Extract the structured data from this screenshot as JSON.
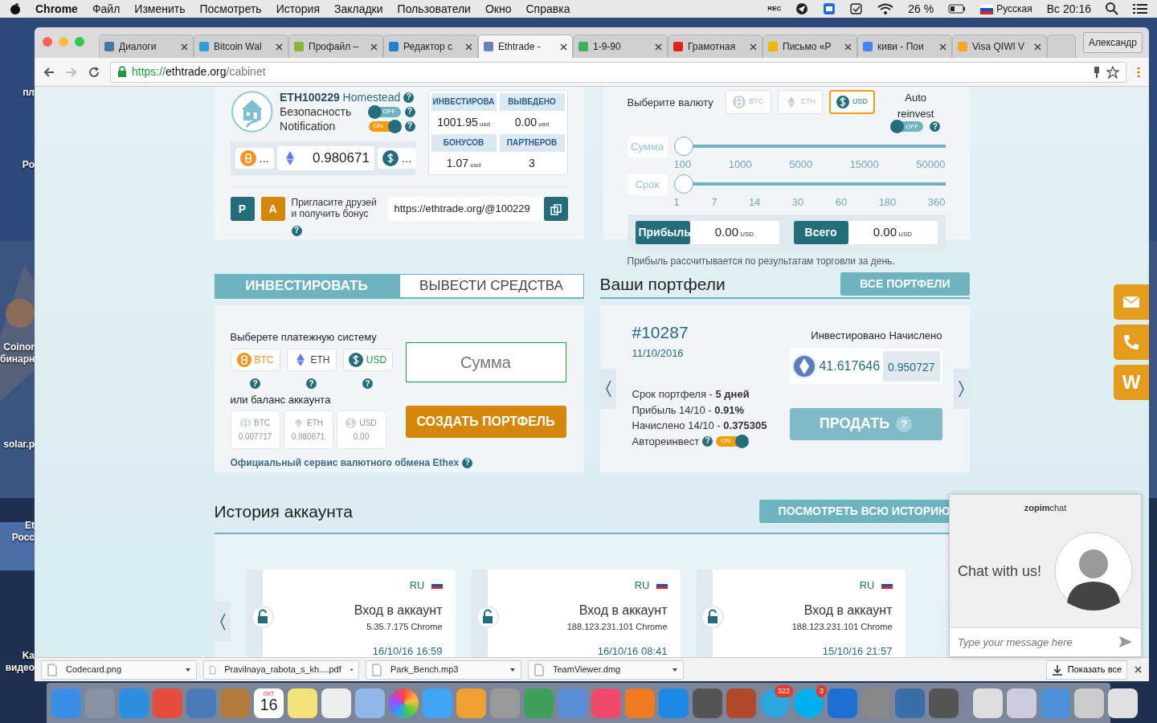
{
  "menubar": {
    "app": "Chrome",
    "items": [
      "Файл",
      "Изменить",
      "Посмотреть",
      "История",
      "Закладки",
      "Пользователи",
      "Окно",
      "Справка"
    ],
    "rec": "REC",
    "battery": "26 %",
    "input_source": "Русская",
    "clock": "Вс 20:16"
  },
  "desktop_icons": [
    {
      "lines": [
        "пл"
      ]
    },
    {
      "lines": [
        "Po"
      ]
    },
    {
      "lines": [
        "Coinor",
        "бинарн"
      ]
    },
    {
      "lines": [
        "solar.p"
      ]
    },
    {
      "lines": [
        "Et",
        "Росс"
      ]
    },
    {
      "lines": [
        "Ka",
        "видео"
      ]
    }
  ],
  "browser": {
    "tabs": [
      {
        "title": "Диалоги",
        "color": "#4a76a8",
        "selected": false
      },
      {
        "title": "Bitcoin Wal",
        "color": "#2a9fd6",
        "selected": false
      },
      {
        "title": "Профайл –",
        "color": "#8db33a",
        "selected": false
      },
      {
        "title": "Редактор с",
        "color": "#1f7fd1",
        "selected": false
      },
      {
        "title": "Ethtrade - ",
        "color": "#6b7fb8",
        "selected": true
      },
      {
        "title": "1-9-90",
        "color": "#3cb55a",
        "selected": false
      },
      {
        "title": "Грамотная",
        "color": "#e62117",
        "selected": false
      },
      {
        "title": "Письмо «Р",
        "color": "#f2b705",
        "selected": false
      },
      {
        "title": "киви - Пои",
        "color": "#4285f4",
        "selected": false
      },
      {
        "title": "Visa QIWI V",
        "color": "#f5a623",
        "selected": false
      }
    ],
    "profile": "Александр",
    "url": {
      "scheme": "https://",
      "host": "ethtrade.org",
      "path": "/cabinet"
    }
  },
  "account": {
    "id": "ETH100229",
    "name": "Homestead",
    "help": "?",
    "toggles": [
      {
        "label": "Безопасность",
        "on": false,
        "text": "OFF",
        "help": "?"
      },
      {
        "label": "Notification",
        "on": true,
        "text": "ON",
        "help": "?"
      }
    ],
    "balances": [
      {
        "kind": "btc",
        "value": "..."
      },
      {
        "kind": "eth",
        "value": "0.980671"
      },
      {
        "kind": "usd",
        "value": "..."
      }
    ],
    "stats": [
      {
        "label": "ИНВЕСТИРОВА",
        "value": "1001.95",
        "unit": "usd"
      },
      {
        "label": "ВЫВЕДЕНО",
        "value": "0.00",
        "unit": "usd"
      },
      {
        "label": "БОНУСОВ",
        "value": "1.07",
        "unit": "usd"
      },
      {
        "label": "ПАРТНЕРОВ",
        "value": "3"
      }
    ],
    "referral": {
      "buttons": [
        {
          "label": "P",
          "color": "#236e7a"
        },
        {
          "label": "A",
          "color": "#d4870a"
        }
      ],
      "text": "Пригласите друзей и получить бонус",
      "help": "?",
      "link": "https://ethtrade.org/@100229"
    }
  },
  "calculator": {
    "title": "Выберите валюту",
    "currencies": [
      {
        "kind": "btc",
        "label": "BTC",
        "selected": false
      },
      {
        "kind": "eth",
        "label": "ETH",
        "selected": false
      },
      {
        "kind": "usd",
        "label": "USD",
        "selected": true
      }
    ],
    "auto_reinvest": {
      "label": "Auto reinvest",
      "on": false,
      "text": "OFF",
      "help": "?"
    },
    "sliders": [
      {
        "label": "Сумма",
        "level": 0,
        "ticks": [
          "100",
          "1000",
          "5000",
          "15000",
          "50000"
        ]
      },
      {
        "label": "Срок",
        "level": 0,
        "ticks": [
          "1",
          "7",
          "14",
          "30",
          "60",
          "180",
          "360"
        ]
      }
    ],
    "results": [
      {
        "label": "Прибыль",
        "value": "0.00",
        "unit": "USD"
      },
      {
        "label": "Всего",
        "value": "0.00",
        "unit": "USD"
      }
    ],
    "note": "Прибыль рассчитывается по результатам торговли за день."
  },
  "invest": {
    "tabs": [
      {
        "label": "ИНВЕСТИРОВАТЬ",
        "selected": true
      },
      {
        "label": "ВЫВЕСТИ СРЕДСТВА",
        "selected": false
      }
    ],
    "payment_label": "Выберете платежную систему",
    "systems": [
      {
        "kind": "btc",
        "label": "BTC",
        "help": "?"
      },
      {
        "kind": "eth",
        "label": "ETH",
        "help": "?"
      },
      {
        "kind": "usd",
        "label": "USD",
        "help": "?"
      }
    ],
    "balance_label": "или баланс аккаунта",
    "balances": [
      {
        "kind": "btc",
        "label": "BTC",
        "value": "0.007717"
      },
      {
        "kind": "eth",
        "label": "ETH",
        "value": "0.980671"
      },
      {
        "kind": "usd",
        "label": "USD",
        "value": "0.00"
      }
    ],
    "amount_placeholder": "Сумма",
    "create_button": "СОЗДАТЬ ПОРТФЕЛЬ",
    "exchange_link": "Официальный сервис валютного обмена Ethex",
    "exchange_help": "?"
  },
  "portfolios": {
    "title": "Ваши портфели",
    "all_button": "ВСЕ ПОРТФЕЛИ",
    "item": {
      "number": "#10287",
      "date": "11/10/2016",
      "invested_label": "Инвестировано",
      "accrued_label": "Начислено",
      "invested": "41.617646",
      "accrued": "0.950727",
      "details": [
        "Срок портфеля - **5 дней**",
        "Прибыль 14/10 - **0.91%**",
        "Начислено 14/10 - **0.375305**"
      ],
      "reinvest": {
        "label": "Автореинвест",
        "help": "?",
        "on": true,
        "text": "ON"
      },
      "sell_button": "ПРОДАТЬ",
      "sell_help": "?"
    }
  },
  "history": {
    "title": "История аккаунта",
    "all_button": "ПОСМОТРЕТЬ ВСЮ ИСТОРИЮ",
    "events": [
      {
        "country": "RU",
        "title": "Вход в аккаунт",
        "detail": "5.35.7.175 Chrome",
        "time": "16/10/16 16:59"
      },
      {
        "country": "RU",
        "title": "Вход в аккаунт",
        "detail": "188.123.231.101 Chrome",
        "time": "16/10/16 08:41"
      },
      {
        "country": "RU",
        "title": "Вход в аккаунт",
        "detail": "188.123.231.101 Chrome",
        "time": "15/10/16 21:57"
      }
    ]
  },
  "side_widget_letter": "W",
  "chat": {
    "brand": "**zopim**chat",
    "greeting": "Chat with us!",
    "placeholder": "Type your message here"
  },
  "downloads": {
    "files": [
      "Codecard.png",
      "Pravilnaya_rabota_s_kh....pdf",
      "Park_Bench.mp3",
      "TeamViewer.dmg"
    ],
    "show_all": "Показать все"
  },
  "dock": {
    "calendar_month": "ОКТ",
    "calendar_day": "16",
    "badges": [
      "322",
      "3"
    ]
  }
}
